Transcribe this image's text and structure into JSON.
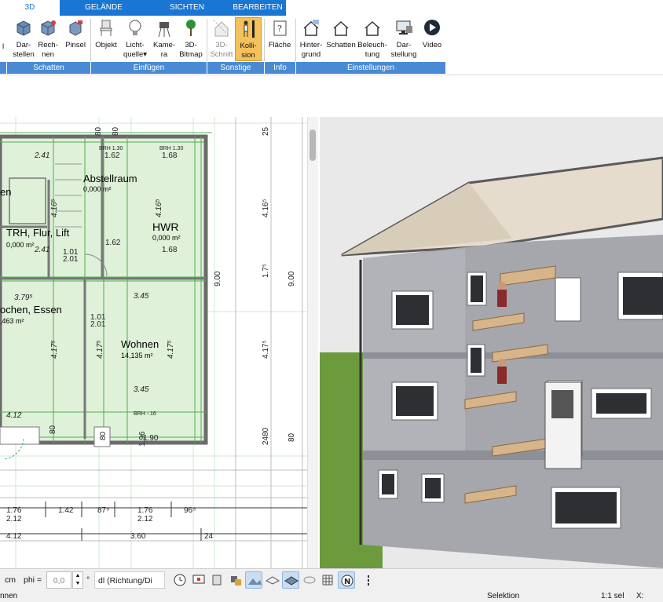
{
  "tabs": [
    {
      "label": "3D",
      "active": true
    },
    {
      "label": "GELÄNDE",
      "active": false
    },
    {
      "label": "SICHTEN",
      "active": false
    },
    {
      "label": "BEARBEITEN",
      "active": false
    }
  ],
  "ribbon": {
    "buttons": [
      {
        "line1": "Dar-",
        "line2": "stellen",
        "icon": "cube-view-icon"
      },
      {
        "line1": "Rech-",
        "line2": "nen",
        "icon": "cube-calc-icon"
      },
      {
        "line1": "Pinsel",
        "line2": "",
        "icon": "brush-cube-icon"
      },
      {
        "line1": "Objekt",
        "line2": "",
        "icon": "chair-icon"
      },
      {
        "line1": "Licht-",
        "line2": "quelle▾",
        "icon": "lightbulb-icon"
      },
      {
        "line1": "Kame-",
        "line2": "ra",
        "icon": "camera-icon"
      },
      {
        "line1": "3D-",
        "line2": "Bitmap",
        "icon": "tree-icon"
      },
      {
        "line1": "3D-",
        "line2": "Schnitt",
        "icon": "section-icon"
      },
      {
        "line1": "Kolli-",
        "line2": "sion",
        "icon": "collision-icon"
      },
      {
        "line1": "Fläche",
        "line2": "",
        "icon": "area-info-icon"
      },
      {
        "line1": "Hinter-",
        "line2": "grund",
        "icon": "house-bg-icon"
      },
      {
        "line1": "Schatten",
        "line2": "",
        "icon": "house-shadow-icon"
      },
      {
        "line1": "Beleuch-",
        "line2": "tung",
        "icon": "house-light-icon"
      },
      {
        "line1": "Dar-",
        "line2": "stellung",
        "icon": "monitor-icon"
      },
      {
        "line1": "Video",
        "line2": "",
        "icon": "play-icon"
      }
    ],
    "groups": [
      "Schatten",
      "Einfügen",
      "Sonstige",
      "Info",
      "Einstellungen"
    ]
  },
  "plan": {
    "rooms": [
      {
        "name": "Abstellraum",
        "area": "0,000 m²"
      },
      {
        "name": "HWR",
        "area": "0,000 m²"
      },
      {
        "name": "TRH, Flur, Lift",
        "area": "0,000 m²"
      },
      {
        "name": "ochen, Essen",
        "area": ",463 m²"
      },
      {
        "name": "Wohnen",
        "area": "14,135 m²"
      },
      {
        "name": "en",
        "area": ""
      }
    ],
    "dims": [
      "2.41",
      "1.62",
      "1.68",
      "BRH 1.30",
      "BRH 1.30",
      "4.16⁵",
      "4.16⁵",
      "2.41",
      "1.01",
      "2.01",
      "1.62",
      "1.68",
      "3.79⁵",
      "3.45",
      "1.01",
      "2.01",
      "4.17⁵",
      "4.17⁵",
      "4.17⁵",
      "3.45",
      "4.12",
      "BRH -.16",
      "80",
      "80",
      "1.90",
      "1.96",
      "9.00",
      "9.00",
      "25",
      "4.16⁵",
      "1.7⁵",
      "4.17⁵",
      "2480",
      "80",
      "1.76",
      "2.12",
      "1.42",
      "87⁵",
      "1.76",
      "2.12",
      "96⁵",
      "4.12",
      "3.60",
      "24",
      "80",
      "80"
    ]
  },
  "toolbar": {
    "unit": "cm",
    "phi_label": "phi =",
    "phi_value": "0,0",
    "degree": "°",
    "dl_value": "dl (Richtung/Di"
  },
  "status": {
    "left": "nnen",
    "mode": "Selektion",
    "scale": "1:1 sel",
    "coord": "X:"
  }
}
